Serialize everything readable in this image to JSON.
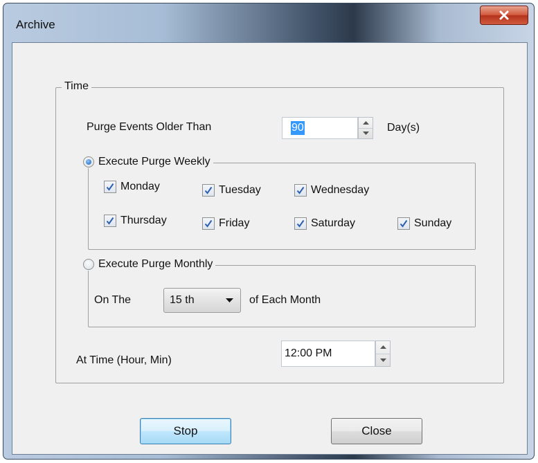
{
  "window": {
    "title": "Archive",
    "close_glyph": "x"
  },
  "time_group": {
    "legend": "Time",
    "purge_label": "Purge Events Older Than",
    "purge_value": "90",
    "purge_unit": "Day(s)"
  },
  "weekly": {
    "legend": "Execute Purge Weekly",
    "selected": true,
    "days": [
      {
        "label": "Monday",
        "checked": true
      },
      {
        "label": "Tuesday",
        "checked": true
      },
      {
        "label": "Wednesday",
        "checked": true
      },
      {
        "label": "Thursday",
        "checked": true
      },
      {
        "label": "Friday",
        "checked": true
      },
      {
        "label": "Saturday",
        "checked": true
      },
      {
        "label": "Sunday",
        "checked": true
      }
    ]
  },
  "monthly": {
    "legend": "Execute Purge Monthly",
    "selected": false,
    "on_the_label": "On The",
    "day_value": "15 th",
    "each_month_label": "of Each Month"
  },
  "at_time": {
    "label": "At Time (Hour, Min)",
    "value": "12:00 PM"
  },
  "buttons": {
    "stop": "Stop",
    "close": "Close"
  },
  "colors": {
    "selection": "#3399ff",
    "check": "#2a5fb0",
    "close_button": "#c9462b"
  }
}
